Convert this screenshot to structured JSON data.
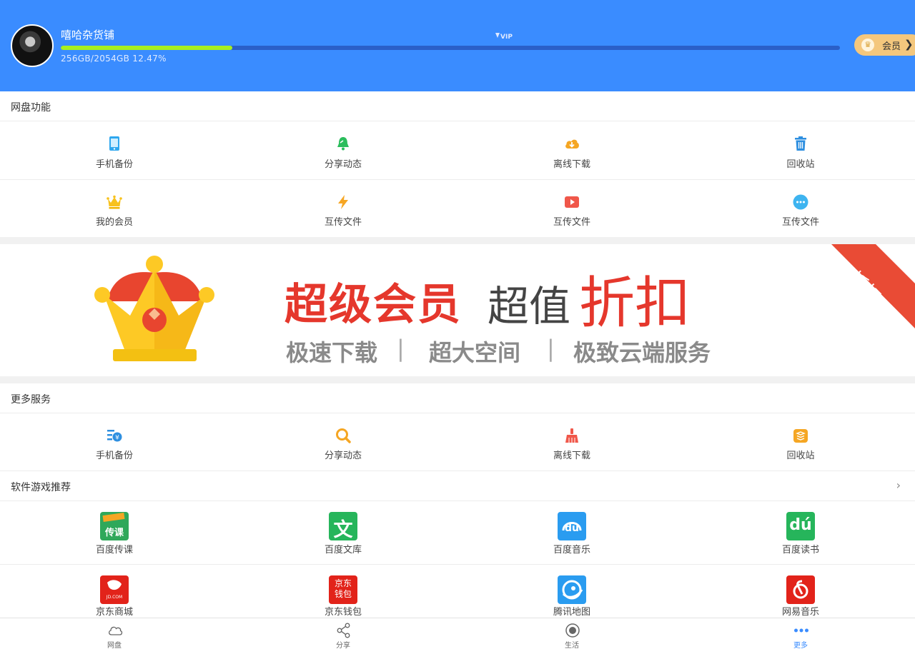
{
  "header": {
    "username": "嘻哈杂货铺",
    "vip_badge": "VIP",
    "storage_text": "256GB/2054GB 12.47%",
    "storage_fraction": 0.2203,
    "member_button": "会员",
    "bg_color": "#3a8cff",
    "progress_color": "#a7ef1f"
  },
  "netdisk": {
    "title": "网盘功能",
    "row1": [
      {
        "label": "手机备份",
        "icon": "phone-icon"
      },
      {
        "label": "分享动态",
        "icon": "bell-icon"
      },
      {
        "label": "离线下载",
        "icon": "cloud-download-icon"
      },
      {
        "label": "回收站",
        "icon": "trash-icon"
      }
    ],
    "row2": [
      {
        "label": "我的会员",
        "icon": "crown-icon"
      },
      {
        "label": "互传文件",
        "icon": "lightning-icon"
      },
      {
        "label": "互传文件",
        "icon": "video-play-icon"
      },
      {
        "label": "互传文件",
        "icon": "more-dots-icon"
      }
    ]
  },
  "banner": {
    "headline": "超级会员",
    "sub_gray": "超值",
    "sub_red": "折扣",
    "tagline": [
      "极速下载",
      "超大空间",
      "极致云端服务"
    ],
    "separator": "|",
    "ribbon": "折扣"
  },
  "more_services": {
    "title": "更多服务",
    "items": [
      {
        "label": "手机备份",
        "icon": "finance-list-icon"
      },
      {
        "label": "分享动态",
        "icon": "search-icon"
      },
      {
        "label": "离线下载",
        "icon": "broom-icon"
      },
      {
        "label": "回收站",
        "icon": "stack-icon"
      }
    ]
  },
  "recommend": {
    "title": "软件游戏推荐",
    "arrow": "›",
    "row1": [
      {
        "label": "百度传课",
        "icon": "chuanke-app-icon",
        "icon_text": "传课"
      },
      {
        "label": "百度文库",
        "icon": "wenku-app-icon",
        "icon_text": "文"
      },
      {
        "label": "百度音乐",
        "icon": "baidu-music-app-icon",
        "icon_text": "du"
      },
      {
        "label": "百度读书",
        "icon": "baidu-read-app-icon",
        "icon_text": "dú"
      }
    ],
    "row2": [
      {
        "label": "京东商城",
        "icon": "jd-app-icon",
        "icon_text": "JD.COM"
      },
      {
        "label": "京东钱包",
        "icon": "jd-wallet-app-icon",
        "icon_text": "京东钱包"
      },
      {
        "label": "腾讯地图",
        "icon": "tencent-map-app-icon",
        "icon_text": ""
      },
      {
        "label": "网易音乐",
        "icon": "netease-music-app-icon",
        "icon_text": ""
      }
    ]
  },
  "tabbar": [
    {
      "label": "网盘",
      "icon": "cloud-icon",
      "active": false
    },
    {
      "label": "分享",
      "icon": "share-icon",
      "active": false
    },
    {
      "label": "生活",
      "icon": "record-icon",
      "active": false
    },
    {
      "label": "更多",
      "icon": "more-icon",
      "active": true
    }
  ]
}
